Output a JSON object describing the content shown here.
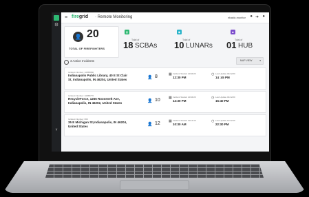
{
  "app": {
    "brand_primary": "fire",
    "brand_secondary": "grid",
    "subtitle": "· Remote Monitoring",
    "user": "elastic.monitor",
    "accent": "#2eb872"
  },
  "stats": {
    "total": {
      "value": "20",
      "label": "TOTAL OF FIREFIGHTERS"
    },
    "scbas": {
      "value": "18",
      "unit": "SCBAs",
      "label": "Total of",
      "icon": "scba-icon",
      "color": "#2eb872"
    },
    "lunars": {
      "value": "10",
      "unit": "LUNARs",
      "label": "Total of",
      "icon": "lunar-icon",
      "color": "#27b3c9"
    },
    "hub": {
      "value": "01",
      "unit": "HUB",
      "label": "Total of",
      "icon": "hub-icon",
      "color": "#7c4dcc"
    }
  },
  "incidents_header": {
    "title": "3 Active Incidents",
    "map_button": "MAP VIEW"
  },
  "incidents": [
    {
      "number": "Incident Number: 10058980",
      "address": "Indianapolis Public Library, 40 E St Clair St, Indianapolis, IN 46204, United States",
      "count": "8",
      "started_label": "Incident Started 12/04/20",
      "started": "12:30 PM",
      "update_label": "Last Update 04/12/20",
      "update": "14 :45 PM"
    },
    {
      "number": "Incident Number: 10058776",
      "address": "RecycleForce, 1255 Roosevelt Ave, Indianapolis, IN 46202, United States",
      "count": "10",
      "started_label": "Incident Started 12/04/20",
      "started": "12:30 PM",
      "update_label": "Last Update 04/12/20",
      "update": "15:40 PM"
    },
    {
      "number": "Incident Number: 869",
      "address": "35 E Michigan St,Indianapolis, IN 46204, United States",
      "count": "12",
      "started_label": "Incident Started 12/12/19",
      "started": "10:30 AM",
      "update_label": "Last Update 12/12/19",
      "update": "22:30 PM"
    }
  ]
}
